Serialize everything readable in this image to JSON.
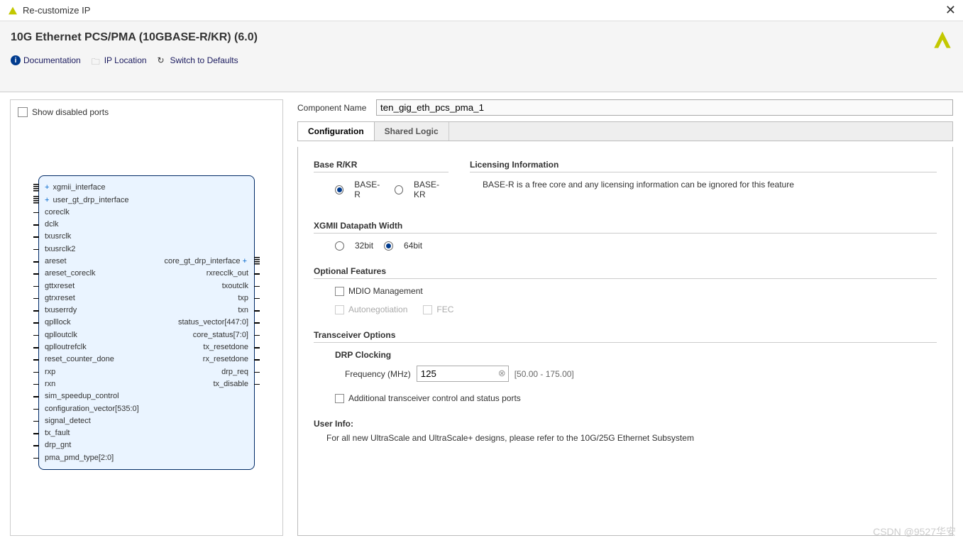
{
  "window": {
    "title": "Re-customize IP"
  },
  "header": {
    "title": "10G Ethernet PCS/PMA (10GBASE-R/KR) (6.0)",
    "links": {
      "doc": "Documentation",
      "loc": "IP Location",
      "defaults": "Switch to Defaults"
    }
  },
  "left": {
    "show_disabled_label": "Show disabled ports",
    "ports_left": [
      "xgmii_interface",
      "user_gt_drp_interface",
      "coreclk",
      "dclk",
      "txusrclk",
      "txusrclk2",
      "areset",
      "areset_coreclk",
      "gttxreset",
      "gtrxreset",
      "txuserrdy",
      "qplllock",
      "qplloutclk",
      "qplloutrefclk",
      "reset_counter_done",
      "rxp",
      "rxn",
      "sim_speedup_control",
      "configuration_vector[535:0]",
      "signal_detect",
      "tx_fault",
      "drp_gnt",
      "pma_pmd_type[2:0]"
    ],
    "ports_right": {
      "6": "core_gt_drp_interface",
      "7": "rxrecclk_out",
      "8": "txoutclk",
      "9": "txp",
      "10": "txn",
      "11": "status_vector[447:0]",
      "12": "core_status[7:0]",
      "13": "tx_resetdone",
      "14": "rx_resetdone",
      "15": "drp_req",
      "16": "tx_disable"
    }
  },
  "config": {
    "comp_label": "Component Name",
    "comp_value": "ten_gig_eth_pcs_pma_1",
    "tabs": {
      "t0": "Configuration",
      "t1": "Shared Logic"
    },
    "base": {
      "title": "Base R/KR",
      "opt_r": "BASE-R",
      "opt_kr": "BASE-KR"
    },
    "license": {
      "title": "Licensing Information",
      "text": "BASE-R is a free core and any licensing information can be ignored for this feature"
    },
    "width": {
      "title": "XGMII Datapath Width",
      "o32": "32bit",
      "o64": "64bit"
    },
    "optional": {
      "title": "Optional Features",
      "mdio": "MDIO Management",
      "autoneg": "Autonegotiation",
      "fec": "FEC"
    },
    "transceiver": {
      "title": "Transceiver Options",
      "drp": "DRP Clocking",
      "freq_label": "Frequency (MHz)",
      "freq_value": "125",
      "freq_range": "[50.00 - 175.00]",
      "add_ctrl": "Additional transceiver control and status ports"
    },
    "user_info": {
      "title": "User Info:",
      "text": "For all new UltraScale and UltraScale+ designs, please refer to the 10G/25G Ethernet Subsystem"
    }
  },
  "watermark": "CSDN @9527华安"
}
